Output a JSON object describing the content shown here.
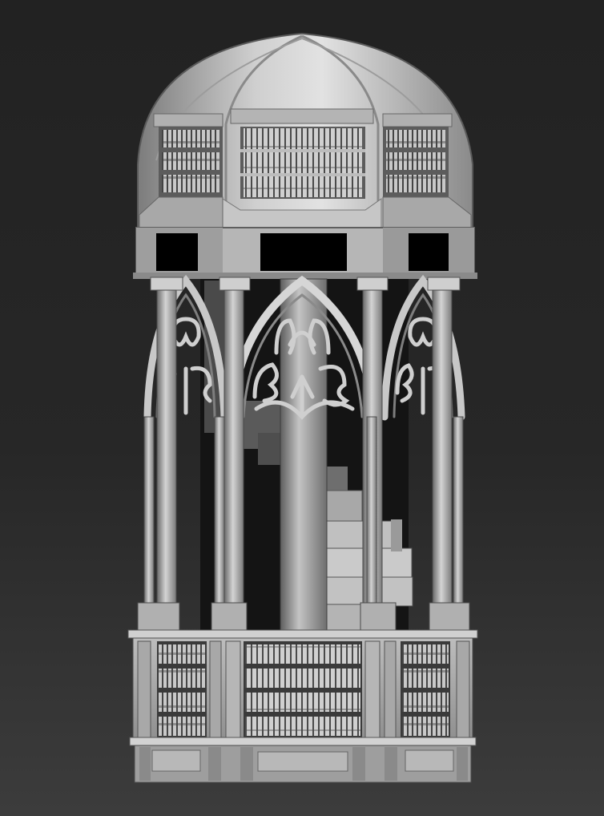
{
  "scene": {
    "subject": "gothic-library-rotunda-sculpt",
    "parts": [
      "dome",
      "dome-bookshelves",
      "dome-window-openings",
      "columns",
      "gothic-arches",
      "tracery",
      "central-pillar",
      "spiral-stair",
      "base-bookshelves",
      "plinth"
    ]
  },
  "palette": {
    "background_top": "#222222",
    "background_bottom": "#3c3c3c",
    "stone_light": "#cfcfcf",
    "stone_mid": "#a6a6a6",
    "stone_dark": "#6e6e6e",
    "shadow": "#3a3a3a",
    "void": "#000000"
  }
}
